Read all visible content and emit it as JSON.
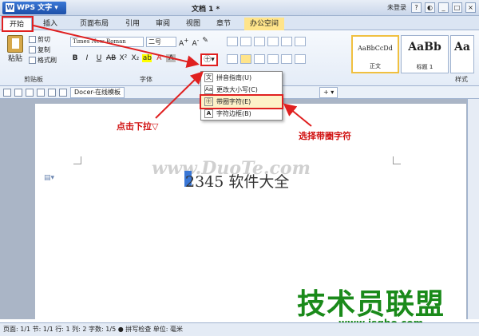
{
  "titlebar": {
    "app_label": "WPS 文字",
    "app_logo": "W",
    "doc_title": "文档 1 *",
    "login": "未登录"
  },
  "tabs": [
    "开始",
    "插入",
    "页面布局",
    "引用",
    "审阅",
    "视图",
    "章节",
    "办公空间"
  ],
  "clipboard": {
    "paste": "粘贴",
    "cut": "剪切",
    "copy": "复制",
    "format_painter": "格式刷",
    "group": "剪贴板"
  },
  "font": {
    "name": "Times New Roman",
    "size": "二号",
    "group": "字体"
  },
  "styles": {
    "items": [
      {
        "sample": "AaBbCcDd",
        "name": "正文"
      },
      {
        "sample": "AaBb",
        "name": "标题 1"
      },
      {
        "sample": "Aa",
        "name": ""
      }
    ],
    "group": "样式"
  },
  "toolbar2": {
    "doc_tab": "Docer-在线模板"
  },
  "menu": {
    "items": [
      "拼音指南(U)",
      "更改大小写(C)",
      "带圈字符(E)",
      "字符边框(B)"
    ]
  },
  "document": {
    "text": "2345 软件大全",
    "watermark": "www.DuoTe.com"
  },
  "annotations": {
    "left": "点击下拉▽",
    "right": "选择带圈字符"
  },
  "brand": {
    "name": "技术员联盟",
    "url": "www.jsgho.com"
  },
  "status": {
    "text": "页面: 1/1  节: 1/1  行: 1  列: 2  字数: 1/5  ● 拼写检查  单位: 毫米"
  },
  "colors": {
    "accent": "#e02020",
    "brand": "#1a8a1a"
  }
}
